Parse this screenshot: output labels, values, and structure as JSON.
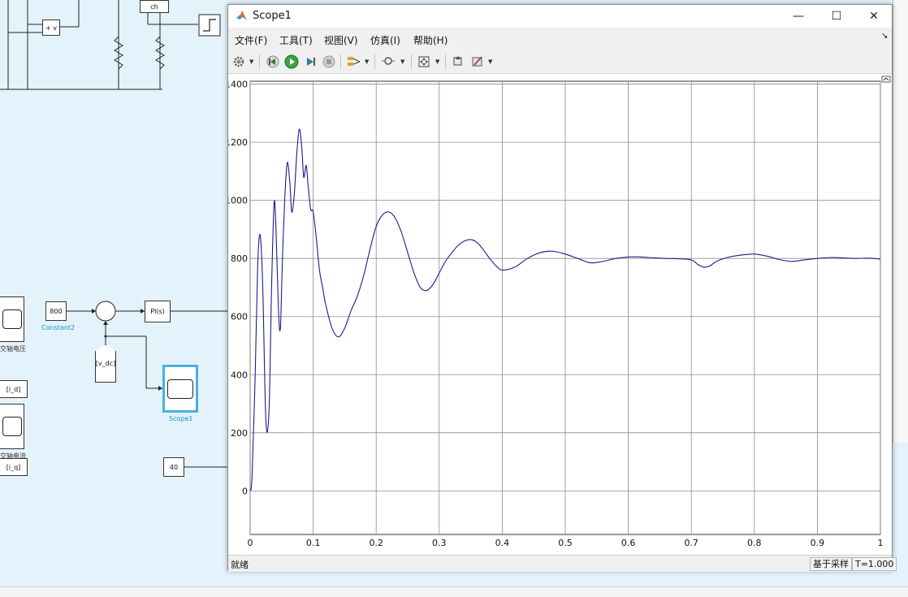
{
  "canvas": {
    "constant_value": "800",
    "constant_label": "Constant2",
    "pi_label": "PI(s)",
    "goto_vdc": "[v_dc]",
    "scope_block_label": "Scope1",
    "const40": "40",
    "tag_id": "[i_d]",
    "tag_iq": "[i_q]",
    "label_voltage": "交轴电压",
    "label_current": "交轴电流",
    "sum_signs": "+ −",
    "mini_block_v": "+ v",
    "mini_block_ch": "ch"
  },
  "window": {
    "title": "Scope1",
    "minimize": "—",
    "maximize": "☐",
    "close": "✕"
  },
  "menu": {
    "file": "文件(F)",
    "tools": "工具(T)",
    "view": "视图(V)",
    "simulation": "仿真(I)",
    "help": "帮助(H)"
  },
  "toolbar": {
    "icons": [
      "gear-icon",
      "step-back-icon",
      "run-icon",
      "step-forward-icon",
      "stop-icon",
      "signal-select-icon",
      "zoom-icon",
      "fit-axes-icon",
      "cursor-icon",
      "style-icon"
    ]
  },
  "status": {
    "state": "就绪",
    "sampling": "基于采样",
    "time": "T=1.000"
  },
  "chart_data": {
    "type": "line",
    "xlim": [
      0,
      1
    ],
    "ylim": [
      -150,
      1410
    ],
    "xticks": [
      "0",
      "0.1",
      "0.2",
      "0.3",
      "0.4",
      "0.5",
      "0.6",
      "0.7",
      "0.8",
      "0.9",
      "1"
    ],
    "yticks": [
      "0",
      "200",
      "400",
      "600",
      "800",
      "1000",
      "1200",
      "1400"
    ],
    "grid": true,
    "line_color": "#1c1c8a",
    "series": [
      {
        "x": [
          0,
          0.003,
          0.008,
          0.012,
          0.016,
          0.02,
          0.025,
          0.03,
          0.034,
          0.038,
          0.041,
          0.045,
          0.048,
          0.051,
          0.055,
          0.059,
          0.063,
          0.066,
          0.07,
          0.074,
          0.078,
          0.082,
          0.085,
          0.089,
          0.092,
          0.096,
          0.1,
          0.105,
          0.11,
          0.115,
          0.12,
          0.13,
          0.14,
          0.15,
          0.16,
          0.17,
          0.18,
          0.19,
          0.2,
          0.21,
          0.22,
          0.23,
          0.24,
          0.25,
          0.26,
          0.27,
          0.28,
          0.29,
          0.3,
          0.31,
          0.32,
          0.33,
          0.34,
          0.35,
          0.36,
          0.37,
          0.38,
          0.39,
          0.4,
          0.42,
          0.44,
          0.46,
          0.48,
          0.5,
          0.52,
          0.54,
          0.56,
          0.58,
          0.6,
          0.62,
          0.64,
          0.66,
          0.68,
          0.7,
          0.71,
          0.72,
          0.73,
          0.74,
          0.76,
          0.78,
          0.8,
          0.82,
          0.84,
          0.86,
          0.88,
          0.9,
          0.92,
          0.94,
          0.96,
          0.98,
          1.0
        ],
        "y": [
          0,
          50,
          400,
          780,
          880,
          700,
          240,
          280,
          700,
          990,
          900,
          620,
          560,
          780,
          1010,
          1130,
          1060,
          960,
          1020,
          1160,
          1245,
          1180,
          1080,
          1120,
          1050,
          970,
          960,
          870,
          760,
          700,
          640,
          560,
          530,
          560,
          620,
          670,
          740,
          830,
          910,
          950,
          960,
          940,
          890,
          820,
          750,
          700,
          690,
          710,
          750,
          790,
          820,
          845,
          860,
          865,
          855,
          830,
          800,
          775,
          760,
          770,
          800,
          820,
          825,
          815,
          800,
          785,
          790,
          800,
          805,
          805,
          802,
          800,
          799,
          795,
          780,
          770,
          775,
          790,
          805,
          812,
          815,
          808,
          796,
          790,
          795,
          800,
          803,
          802,
          800,
          801,
          798
        ]
      }
    ]
  }
}
